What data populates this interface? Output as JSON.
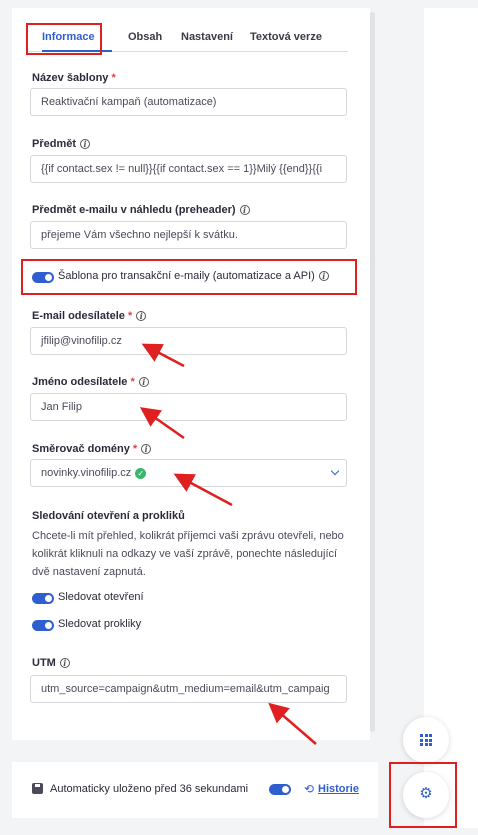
{
  "tabs": [
    "Informace",
    "Obsah",
    "Nastavení",
    "Textová verze"
  ],
  "template_name": {
    "label": "Název šablony",
    "required": "*",
    "value": "Reaktivační kampaň (automatizace)"
  },
  "subject": {
    "label": "Předmět",
    "value": "{{if contact.sex != null}}{{if contact.sex == 1}}Milý {{end}}{{i"
  },
  "preheader": {
    "label": "Předmět e-mailu v náhledu (preheader)",
    "value": "přejeme Vám všechno nejlepší k svátku."
  },
  "transactional": {
    "label": "Šablona pro transakční e-maily (automatizace a API)",
    "on": true
  },
  "sender_email": {
    "label": "E-mail odesílatele",
    "required": "*",
    "value": "jfilip@vinofilip.cz"
  },
  "sender_name": {
    "label": "Jméno odesílatele",
    "required": "*",
    "value": "Jan Filip"
  },
  "domain_router": {
    "label": "Směrovač domény",
    "required": "*",
    "value": "novinky.vinofilip.cz"
  },
  "tracking": {
    "title": "Sledování otevření a prokliků",
    "description": "Chcete-li mít přehled, kolikrát příjemci vaši zprávu otevřeli, nebo kolikrát kliknuli na odkazy ve vaší zprávě, ponechte následující dvě nastavení zapnutá.",
    "opens_label": "Sledovat otevření",
    "clicks_label": "Sledovat prokliky"
  },
  "utm": {
    "label": "UTM",
    "value": "utm_source=campaign&utm_medium=email&utm_campaig"
  },
  "bottom": {
    "autosave": "Automaticky uloženo před 36 sekundami",
    "history": "Historie"
  },
  "colors": {
    "accent": "#2f5fcf",
    "highlight": "#e02020",
    "ok": "#3bb56a"
  },
  "icons": [
    "info-icon",
    "save-icon",
    "history-icon",
    "grid-icon",
    "gear-icon",
    "chevron-down-icon",
    "check-icon"
  ]
}
